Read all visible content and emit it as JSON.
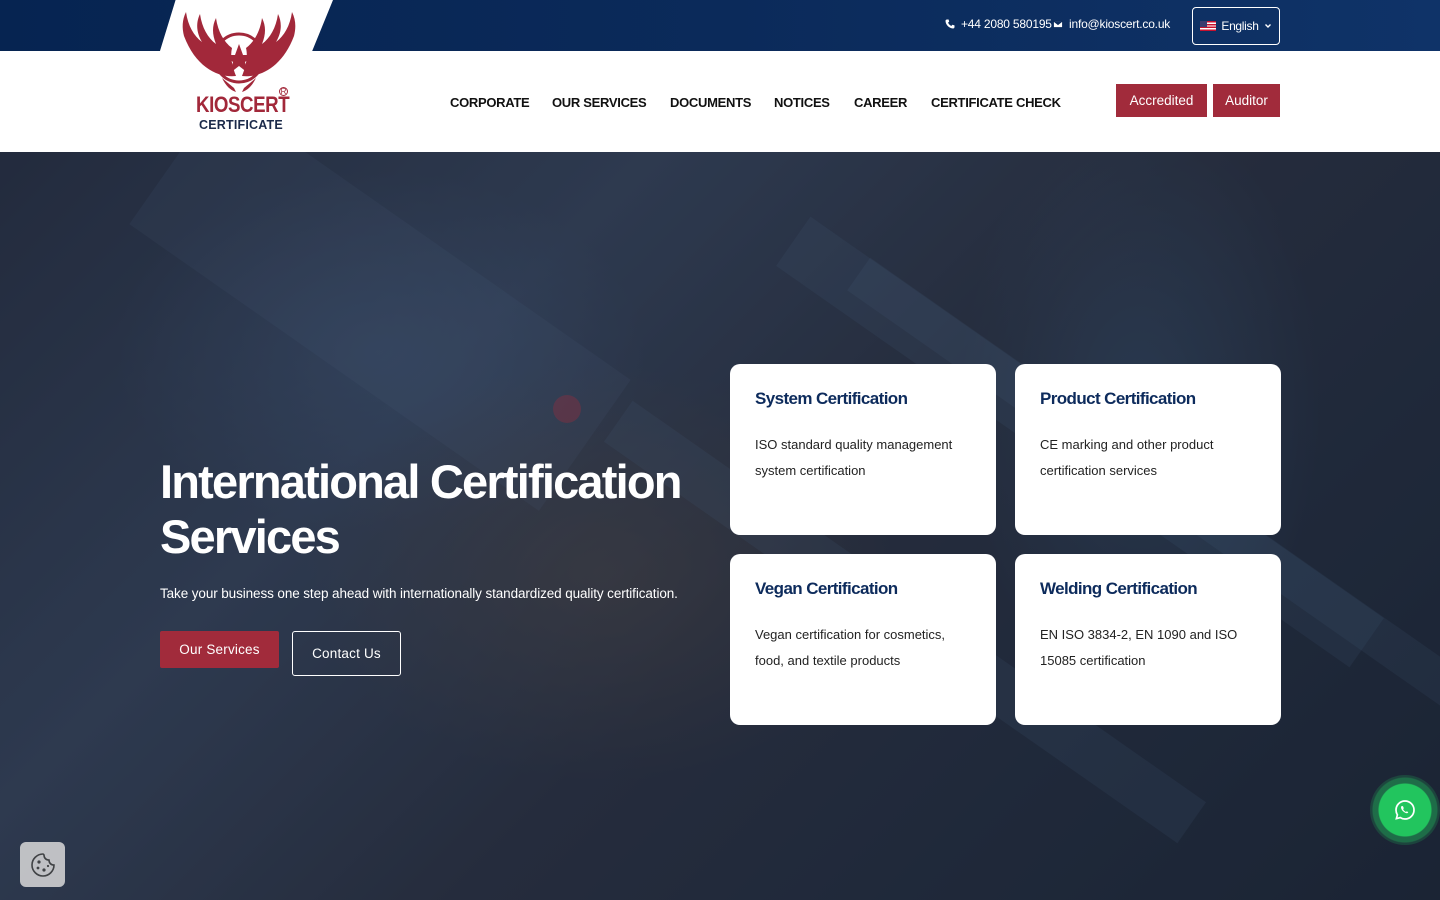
{
  "topbar": {
    "phone": "+44 2080 580195",
    "email": "info@kioscert.co.uk",
    "language": "English"
  },
  "brand": {
    "name": "KIOSCERT",
    "tagline": "CERTIFICATE",
    "registered": "R"
  },
  "nav": {
    "items": [
      "CORPORATE",
      "OUR SERVICES",
      "DOCUMENTS",
      "NOTICES",
      "CAREER",
      "CERTIFICATE CHECK"
    ],
    "accredited_label": "Accredited",
    "auditor_label": "Auditor"
  },
  "hero": {
    "title": "International Certification Services",
    "subtitle": "Take your business one step ahead with internationally standardized quality certification.",
    "primary_button": "Our Services",
    "secondary_button": "Contact Us"
  },
  "cards": [
    {
      "title": "System Certification",
      "desc": "ISO standard quality management system certification"
    },
    {
      "title": "Product Certification",
      "desc": "CE marking and other product certification services"
    },
    {
      "title": "Vegan Certification",
      "desc": "Vegan certification for cosmetics, food, and textile products"
    },
    {
      "title": "Welding Certification",
      "desc": "EN ISO 3834-2, EN 1090 and ISO 15085 certification"
    }
  ],
  "colors": {
    "brand_red": "#a12b3b",
    "navy": "#062451",
    "card_title": "#0d2b5c",
    "whatsapp_green": "#22c55e"
  },
  "icons": {
    "phone": "phone-icon",
    "email": "envelope-icon",
    "flag": "us-flag-icon",
    "cookie": "cookie-icon",
    "whatsapp": "whatsapp-icon"
  }
}
